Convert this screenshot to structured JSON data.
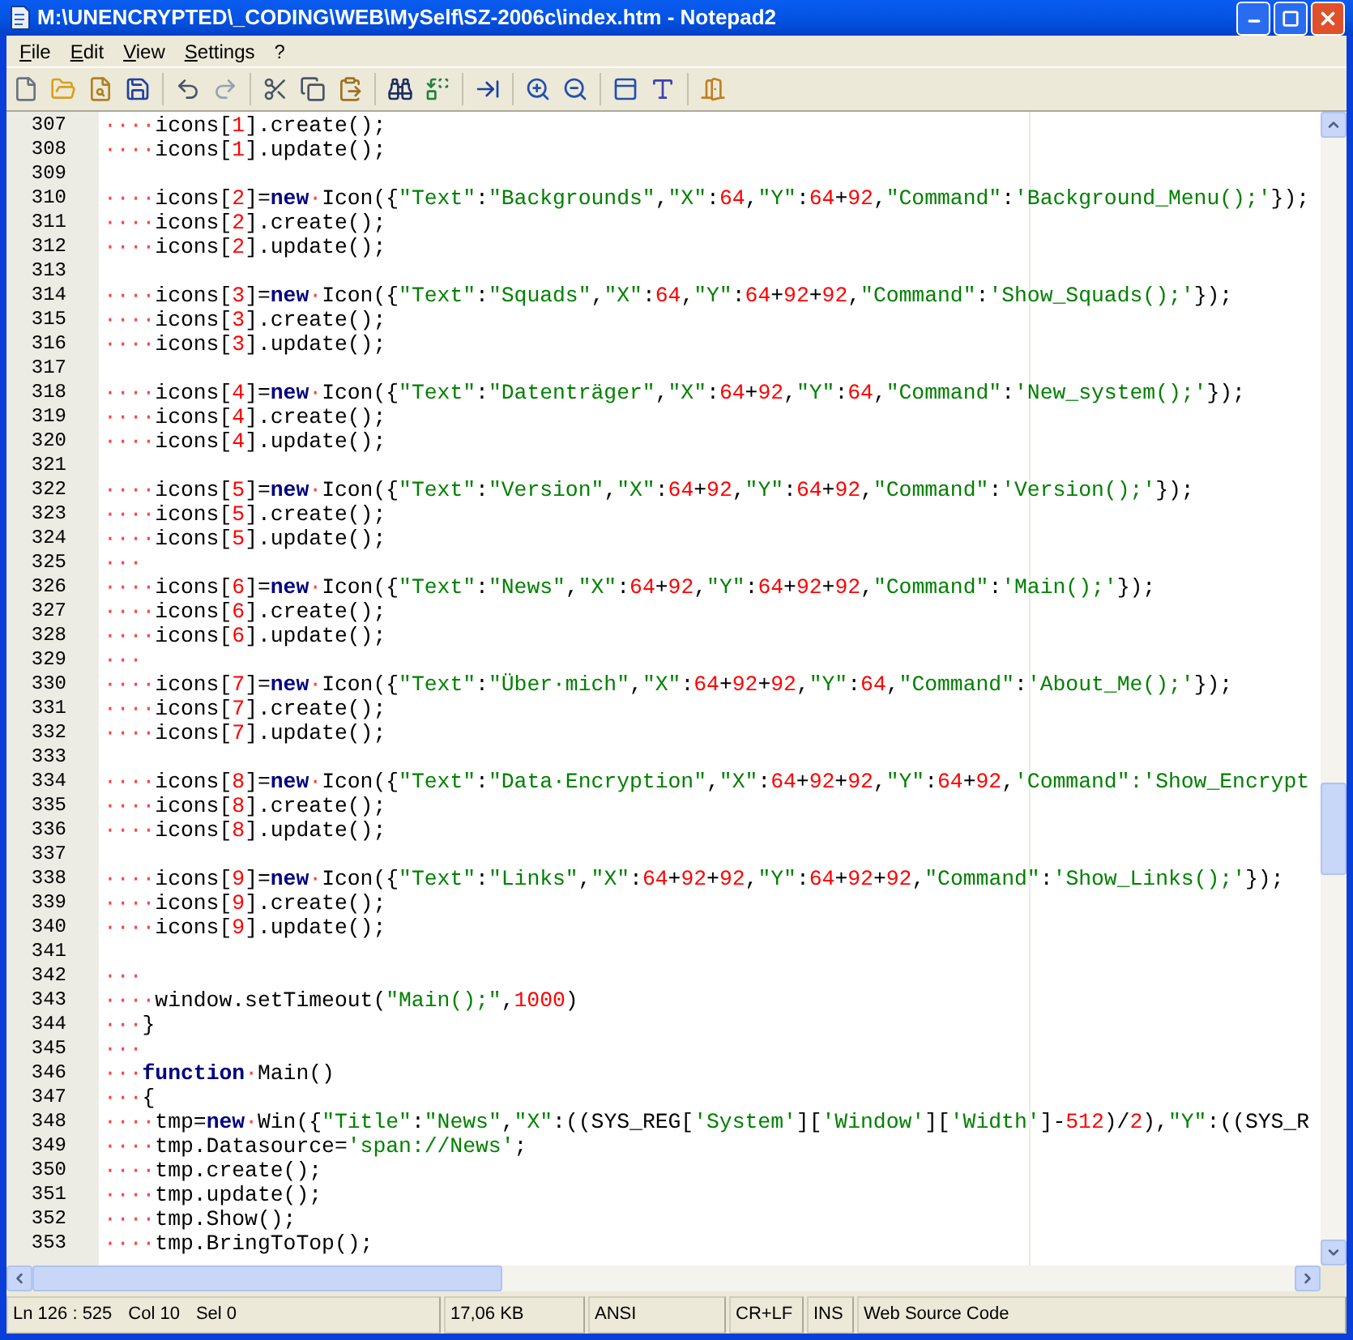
{
  "window": {
    "title": "M:\\UNENCRYPTED\\_CODING\\WEB\\MySelf\\SZ-2006c\\index.htm - Notepad2"
  },
  "menu": [
    {
      "label": "File"
    },
    {
      "label": "Edit"
    },
    {
      "label": "View"
    },
    {
      "label": "Settings"
    },
    {
      "label": "?"
    }
  ],
  "editor": {
    "lines": [
      {
        "number": "307",
        "tokens": [
          {
            "kind": "space",
            "text": "····"
          },
          {
            "kind": "plain",
            "text": "icons["
          },
          {
            "kind": "number",
            "text": "1"
          },
          {
            "kind": "plain",
            "text": "].create();"
          }
        ]
      },
      {
        "number": "308",
        "tokens": [
          {
            "kind": "space",
            "text": "····"
          },
          {
            "kind": "plain",
            "text": "icons["
          },
          {
            "kind": "number",
            "text": "1"
          },
          {
            "kind": "plain",
            "text": "].update();"
          }
        ]
      },
      {
        "number": "309"
      },
      {
        "number": "310",
        "tokens": [
          {
            "kind": "space",
            "text": "····"
          },
          {
            "kind": "plain",
            "text": "icons["
          },
          {
            "kind": "number",
            "text": "2"
          },
          {
            "kind": "plain",
            "text": "]="
          },
          {
            "kind": "keyword",
            "text": "new"
          },
          {
            "kind": "space",
            "text": "·"
          },
          {
            "kind": "plain",
            "text": "Icon({"
          },
          {
            "kind": "string",
            "text": "\"Text\""
          },
          {
            "kind": "plain",
            "text": ":"
          },
          {
            "kind": "string",
            "text": "\"Backgrounds\""
          },
          {
            "kind": "plain",
            "text": ","
          },
          {
            "kind": "string",
            "text": "\"X\""
          },
          {
            "kind": "plain",
            "text": ":"
          },
          {
            "kind": "number",
            "text": "64"
          },
          {
            "kind": "plain",
            "text": ","
          },
          {
            "kind": "string",
            "text": "\"Y\""
          },
          {
            "kind": "plain",
            "text": ":"
          },
          {
            "kind": "number",
            "text": "64"
          },
          {
            "kind": "plain",
            "text": "+"
          },
          {
            "kind": "number",
            "text": "92"
          },
          {
            "kind": "plain",
            "text": ","
          },
          {
            "kind": "string",
            "text": "\"Command\""
          },
          {
            "kind": "plain",
            "text": ":"
          },
          {
            "kind": "string",
            "text": "'Background_Menu();'"
          },
          {
            "kind": "plain",
            "text": "});"
          }
        ]
      },
      {
        "number": "311",
        "tokens": [
          {
            "kind": "space",
            "text": "····"
          },
          {
            "kind": "plain",
            "text": "icons["
          },
          {
            "kind": "number",
            "text": "2"
          },
          {
            "kind": "plain",
            "text": "].create();"
          }
        ]
      },
      {
        "number": "312",
        "tokens": [
          {
            "kind": "space",
            "text": "····"
          },
          {
            "kind": "plain",
            "text": "icons["
          },
          {
            "kind": "number",
            "text": "2"
          },
          {
            "kind": "plain",
            "text": "].update();"
          }
        ]
      },
      {
        "number": "313"
      },
      {
        "number": "314",
        "tokens": [
          {
            "kind": "space",
            "text": "····"
          },
          {
            "kind": "plain",
            "text": "icons["
          },
          {
            "kind": "number",
            "text": "3"
          },
          {
            "kind": "plain",
            "text": "]="
          },
          {
            "kind": "keyword",
            "text": "new"
          },
          {
            "kind": "space",
            "text": "·"
          },
          {
            "kind": "plain",
            "text": "Icon({"
          },
          {
            "kind": "string",
            "text": "\"Text\""
          },
          {
            "kind": "plain",
            "text": ":"
          },
          {
            "kind": "string",
            "text": "\"Squads\""
          },
          {
            "kind": "plain",
            "text": ","
          },
          {
            "kind": "string",
            "text": "\"X\""
          },
          {
            "kind": "plain",
            "text": ":"
          },
          {
            "kind": "number",
            "text": "64"
          },
          {
            "kind": "plain",
            "text": ","
          },
          {
            "kind": "string",
            "text": "\"Y\""
          },
          {
            "kind": "plain",
            "text": ":"
          },
          {
            "kind": "number",
            "text": "64"
          },
          {
            "kind": "plain",
            "text": "+"
          },
          {
            "kind": "number",
            "text": "92"
          },
          {
            "kind": "plain",
            "text": "+"
          },
          {
            "kind": "number",
            "text": "92"
          },
          {
            "kind": "plain",
            "text": ","
          },
          {
            "kind": "string",
            "text": "\"Command\""
          },
          {
            "kind": "plain",
            "text": ":"
          },
          {
            "kind": "string",
            "text": "'Show_Squads();'"
          },
          {
            "kind": "plain",
            "text": "});"
          }
        ]
      },
      {
        "number": "315",
        "tokens": [
          {
            "kind": "space",
            "text": "····"
          },
          {
            "kind": "plain",
            "text": "icons["
          },
          {
            "kind": "number",
            "text": "3"
          },
          {
            "kind": "plain",
            "text": "].create();"
          }
        ]
      },
      {
        "number": "316",
        "tokens": [
          {
            "kind": "space",
            "text": "····"
          },
          {
            "kind": "plain",
            "text": "icons["
          },
          {
            "kind": "number",
            "text": "3"
          },
          {
            "kind": "plain",
            "text": "].update();"
          }
        ]
      },
      {
        "number": "317"
      },
      {
        "number": "318",
        "tokens": [
          {
            "kind": "space",
            "text": "····"
          },
          {
            "kind": "plain",
            "text": "icons["
          },
          {
            "kind": "number",
            "text": "4"
          },
          {
            "kind": "plain",
            "text": "]="
          },
          {
            "kind": "keyword",
            "text": "new"
          },
          {
            "kind": "space",
            "text": "·"
          },
          {
            "kind": "plain",
            "text": "Icon({"
          },
          {
            "kind": "string",
            "text": "\"Text\""
          },
          {
            "kind": "plain",
            "text": ":"
          },
          {
            "kind": "string",
            "text": "\"Datenträger\""
          },
          {
            "kind": "plain",
            "text": ","
          },
          {
            "kind": "string",
            "text": "\"X\""
          },
          {
            "kind": "plain",
            "text": ":"
          },
          {
            "kind": "number",
            "text": "64"
          },
          {
            "kind": "plain",
            "text": "+"
          },
          {
            "kind": "number",
            "text": "92"
          },
          {
            "kind": "plain",
            "text": ","
          },
          {
            "kind": "string",
            "text": "\"Y\""
          },
          {
            "kind": "plain",
            "text": ":"
          },
          {
            "kind": "number",
            "text": "64"
          },
          {
            "kind": "plain",
            "text": ","
          },
          {
            "kind": "string",
            "text": "\"Command\""
          },
          {
            "kind": "plain",
            "text": ":"
          },
          {
            "kind": "string",
            "text": "'New_system();'"
          },
          {
            "kind": "plain",
            "text": "});"
          }
        ]
      },
      {
        "number": "319",
        "tokens": [
          {
            "kind": "space",
            "text": "····"
          },
          {
            "kind": "plain",
            "text": "icons["
          },
          {
            "kind": "number",
            "text": "4"
          },
          {
            "kind": "plain",
            "text": "].create();"
          }
        ]
      },
      {
        "number": "320",
        "tokens": [
          {
            "kind": "space",
            "text": "····"
          },
          {
            "kind": "plain",
            "text": "icons["
          },
          {
            "kind": "number",
            "text": "4"
          },
          {
            "kind": "plain",
            "text": "].update();"
          }
        ]
      },
      {
        "number": "321"
      },
      {
        "number": "322",
        "tokens": [
          {
            "kind": "space",
            "text": "····"
          },
          {
            "kind": "plain",
            "text": "icons["
          },
          {
            "kind": "number",
            "text": "5"
          },
          {
            "kind": "plain",
            "text": "]="
          },
          {
            "kind": "keyword",
            "text": "new"
          },
          {
            "kind": "space",
            "text": "·"
          },
          {
            "kind": "plain",
            "text": "Icon({"
          },
          {
            "kind": "string",
            "text": "\"Text\""
          },
          {
            "kind": "plain",
            "text": ":"
          },
          {
            "kind": "string",
            "text": "\"Version\""
          },
          {
            "kind": "plain",
            "text": ","
          },
          {
            "kind": "string",
            "text": "\"X\""
          },
          {
            "kind": "plain",
            "text": ":"
          },
          {
            "kind": "number",
            "text": "64"
          },
          {
            "kind": "plain",
            "text": "+"
          },
          {
            "kind": "number",
            "text": "92"
          },
          {
            "kind": "plain",
            "text": ","
          },
          {
            "kind": "string",
            "text": "\"Y\""
          },
          {
            "kind": "plain",
            "text": ":"
          },
          {
            "kind": "number",
            "text": "64"
          },
          {
            "kind": "plain",
            "text": "+"
          },
          {
            "kind": "number",
            "text": "92"
          },
          {
            "kind": "plain",
            "text": ","
          },
          {
            "kind": "string",
            "text": "\"Command\""
          },
          {
            "kind": "plain",
            "text": ":"
          },
          {
            "kind": "string",
            "text": "'Version();'"
          },
          {
            "kind": "plain",
            "text": "});"
          }
        ]
      },
      {
        "number": "323",
        "tokens": [
          {
            "kind": "space",
            "text": "····"
          },
          {
            "kind": "plain",
            "text": "icons["
          },
          {
            "kind": "number",
            "text": "5"
          },
          {
            "kind": "plain",
            "text": "].create();"
          }
        ]
      },
      {
        "number": "324",
        "tokens": [
          {
            "kind": "space",
            "text": "····"
          },
          {
            "kind": "plain",
            "text": "icons["
          },
          {
            "kind": "number",
            "text": "5"
          },
          {
            "kind": "plain",
            "text": "].update();"
          }
        ]
      },
      {
        "number": "325",
        "tokens": [
          {
            "kind": "space",
            "text": "···"
          }
        ]
      },
      {
        "number": "326",
        "tokens": [
          {
            "kind": "space",
            "text": "····"
          },
          {
            "kind": "plain",
            "text": "icons["
          },
          {
            "kind": "number",
            "text": "6"
          },
          {
            "kind": "plain",
            "text": "]="
          },
          {
            "kind": "keyword",
            "text": "new"
          },
          {
            "kind": "space",
            "text": "·"
          },
          {
            "kind": "plain",
            "text": "Icon({"
          },
          {
            "kind": "string",
            "text": "\"Text\""
          },
          {
            "kind": "plain",
            "text": ":"
          },
          {
            "kind": "string",
            "text": "\"News\""
          },
          {
            "kind": "plain",
            "text": ","
          },
          {
            "kind": "string",
            "text": "\"X\""
          },
          {
            "kind": "plain",
            "text": ":"
          },
          {
            "kind": "number",
            "text": "64"
          },
          {
            "kind": "plain",
            "text": "+"
          },
          {
            "kind": "number",
            "text": "92"
          },
          {
            "kind": "plain",
            "text": ","
          },
          {
            "kind": "string",
            "text": "\"Y\""
          },
          {
            "kind": "plain",
            "text": ":"
          },
          {
            "kind": "number",
            "text": "64"
          },
          {
            "kind": "plain",
            "text": "+"
          },
          {
            "kind": "number",
            "text": "92"
          },
          {
            "kind": "plain",
            "text": "+"
          },
          {
            "kind": "number",
            "text": "92"
          },
          {
            "kind": "plain",
            "text": ","
          },
          {
            "kind": "string",
            "text": "\"Command\""
          },
          {
            "kind": "plain",
            "text": ":"
          },
          {
            "kind": "string",
            "text": "'Main();'"
          },
          {
            "kind": "plain",
            "text": "});"
          }
        ]
      },
      {
        "number": "327",
        "tokens": [
          {
            "kind": "space",
            "text": "····"
          },
          {
            "kind": "plain",
            "text": "icons["
          },
          {
            "kind": "number",
            "text": "6"
          },
          {
            "kind": "plain",
            "text": "].create();"
          }
        ]
      },
      {
        "number": "328",
        "tokens": [
          {
            "kind": "space",
            "text": "····"
          },
          {
            "kind": "plain",
            "text": "icons["
          },
          {
            "kind": "number",
            "text": "6"
          },
          {
            "kind": "plain",
            "text": "].update();"
          }
        ]
      },
      {
        "number": "329",
        "tokens": [
          {
            "kind": "space",
            "text": "···"
          }
        ]
      },
      {
        "number": "330",
        "tokens": [
          {
            "kind": "space",
            "text": "····"
          },
          {
            "kind": "plain",
            "text": "icons["
          },
          {
            "kind": "number",
            "text": "7"
          },
          {
            "kind": "plain",
            "text": "]="
          },
          {
            "kind": "keyword",
            "text": "new"
          },
          {
            "kind": "space",
            "text": "·"
          },
          {
            "kind": "plain",
            "text": "Icon({"
          },
          {
            "kind": "string",
            "text": "\"Text\""
          },
          {
            "kind": "plain",
            "text": ":"
          },
          {
            "kind": "string",
            "text": "\"Über·mich\""
          },
          {
            "kind": "plain",
            "text": ","
          },
          {
            "kind": "string",
            "text": "\"X\""
          },
          {
            "kind": "plain",
            "text": ":"
          },
          {
            "kind": "number",
            "text": "64"
          },
          {
            "kind": "plain",
            "text": "+"
          },
          {
            "kind": "number",
            "text": "92"
          },
          {
            "kind": "plain",
            "text": "+"
          },
          {
            "kind": "number",
            "text": "92"
          },
          {
            "kind": "plain",
            "text": ","
          },
          {
            "kind": "string",
            "text": "\"Y\""
          },
          {
            "kind": "plain",
            "text": ":"
          },
          {
            "kind": "number",
            "text": "64"
          },
          {
            "kind": "plain",
            "text": ","
          },
          {
            "kind": "string",
            "text": "\"Command\""
          },
          {
            "kind": "plain",
            "text": ":"
          },
          {
            "kind": "string",
            "text": "'About_Me();'"
          },
          {
            "kind": "plain",
            "text": "});"
          }
        ]
      },
      {
        "number": "331",
        "tokens": [
          {
            "kind": "space",
            "text": "····"
          },
          {
            "kind": "plain",
            "text": "icons["
          },
          {
            "kind": "number",
            "text": "7"
          },
          {
            "kind": "plain",
            "text": "].create();"
          }
        ]
      },
      {
        "number": "332",
        "tokens": [
          {
            "kind": "space",
            "text": "····"
          },
          {
            "kind": "plain",
            "text": "icons["
          },
          {
            "kind": "number",
            "text": "7"
          },
          {
            "kind": "plain",
            "text": "].update();"
          }
        ]
      },
      {
        "number": "333"
      },
      {
        "number": "334",
        "tokens": [
          {
            "kind": "space",
            "text": "····"
          },
          {
            "kind": "plain",
            "text": "icons["
          },
          {
            "kind": "number",
            "text": "8"
          },
          {
            "kind": "plain",
            "text": "]="
          },
          {
            "kind": "keyword",
            "text": "new"
          },
          {
            "kind": "space",
            "text": "·"
          },
          {
            "kind": "plain",
            "text": "Icon({"
          },
          {
            "kind": "string",
            "text": "\"Text\""
          },
          {
            "kind": "plain",
            "text": ":"
          },
          {
            "kind": "string",
            "text": "\"Data·Encryption\""
          },
          {
            "kind": "plain",
            "text": ","
          },
          {
            "kind": "string",
            "text": "\"X\""
          },
          {
            "kind": "plain",
            "text": ":"
          },
          {
            "kind": "number",
            "text": "64"
          },
          {
            "kind": "plain",
            "text": "+"
          },
          {
            "kind": "number",
            "text": "92"
          },
          {
            "kind": "plain",
            "text": "+"
          },
          {
            "kind": "number",
            "text": "92"
          },
          {
            "kind": "plain",
            "text": ","
          },
          {
            "kind": "string",
            "text": "\"Y\""
          },
          {
            "kind": "plain",
            "text": ":"
          },
          {
            "kind": "number",
            "text": "64"
          },
          {
            "kind": "plain",
            "text": "+"
          },
          {
            "kind": "number",
            "text": "92"
          },
          {
            "kind": "plain",
            "text": ","
          },
          {
            "kind": "string",
            "text": "'Command\":'Show_Encrypt"
          }
        ]
      },
      {
        "number": "335",
        "tokens": [
          {
            "kind": "space",
            "text": "····"
          },
          {
            "kind": "plain",
            "text": "icons["
          },
          {
            "kind": "number",
            "text": "8"
          },
          {
            "kind": "plain",
            "text": "].create();"
          }
        ]
      },
      {
        "number": "336",
        "tokens": [
          {
            "kind": "space",
            "text": "····"
          },
          {
            "kind": "plain",
            "text": "icons["
          },
          {
            "kind": "number",
            "text": "8"
          },
          {
            "kind": "plain",
            "text": "].update();"
          }
        ]
      },
      {
        "number": "337"
      },
      {
        "number": "338",
        "tokens": [
          {
            "kind": "space",
            "text": "····"
          },
          {
            "kind": "plain",
            "text": "icons["
          },
          {
            "kind": "number",
            "text": "9"
          },
          {
            "kind": "plain",
            "text": "]="
          },
          {
            "kind": "keyword",
            "text": "new"
          },
          {
            "kind": "space",
            "text": "·"
          },
          {
            "kind": "plain",
            "text": "Icon({"
          },
          {
            "kind": "string",
            "text": "\"Text\""
          },
          {
            "kind": "plain",
            "text": ":"
          },
          {
            "kind": "string",
            "text": "\"Links\""
          },
          {
            "kind": "plain",
            "text": ","
          },
          {
            "kind": "string",
            "text": "\"X\""
          },
          {
            "kind": "plain",
            "text": ":"
          },
          {
            "kind": "number",
            "text": "64"
          },
          {
            "kind": "plain",
            "text": "+"
          },
          {
            "kind": "number",
            "text": "92"
          },
          {
            "kind": "plain",
            "text": "+"
          },
          {
            "kind": "number",
            "text": "92"
          },
          {
            "kind": "plain",
            "text": ","
          },
          {
            "kind": "string",
            "text": "\"Y\""
          },
          {
            "kind": "plain",
            "text": ":"
          },
          {
            "kind": "number",
            "text": "64"
          },
          {
            "kind": "plain",
            "text": "+"
          },
          {
            "kind": "number",
            "text": "92"
          },
          {
            "kind": "plain",
            "text": "+"
          },
          {
            "kind": "number",
            "text": "92"
          },
          {
            "kind": "plain",
            "text": ","
          },
          {
            "kind": "string",
            "text": "\"Command\""
          },
          {
            "kind": "plain",
            "text": ":"
          },
          {
            "kind": "string",
            "text": "'Show_Links();'"
          },
          {
            "kind": "plain",
            "text": "});"
          }
        ]
      },
      {
        "number": "339",
        "tokens": [
          {
            "kind": "space",
            "text": "····"
          },
          {
            "kind": "plain",
            "text": "icons["
          },
          {
            "kind": "number",
            "text": "9"
          },
          {
            "kind": "plain",
            "text": "].create();"
          }
        ]
      },
      {
        "number": "340",
        "tokens": [
          {
            "kind": "space",
            "text": "····"
          },
          {
            "kind": "plain",
            "text": "icons["
          },
          {
            "kind": "number",
            "text": "9"
          },
          {
            "kind": "plain",
            "text": "].update();"
          }
        ]
      },
      {
        "number": "341"
      },
      {
        "number": "342",
        "tokens": [
          {
            "kind": "space",
            "text": "···"
          }
        ]
      },
      {
        "number": "343",
        "tokens": [
          {
            "kind": "space",
            "text": "····"
          },
          {
            "kind": "plain",
            "text": "window.setTimeout("
          },
          {
            "kind": "string",
            "text": "\"Main();\""
          },
          {
            "kind": "plain",
            "text": ","
          },
          {
            "kind": "number",
            "text": "1000"
          },
          {
            "kind": "plain",
            "text": ")"
          }
        ]
      },
      {
        "number": "344",
        "tokens": [
          {
            "kind": "space",
            "text": "···"
          },
          {
            "kind": "plain",
            "text": "}"
          }
        ]
      },
      {
        "number": "345",
        "tokens": [
          {
            "kind": "space",
            "text": "···"
          }
        ]
      },
      {
        "number": "346",
        "tokens": [
          {
            "kind": "space",
            "text": "···"
          },
          {
            "kind": "keyword",
            "text": "function"
          },
          {
            "kind": "space",
            "text": "·"
          },
          {
            "kind": "plain",
            "text": "Main()"
          }
        ]
      },
      {
        "number": "347",
        "tokens": [
          {
            "kind": "space",
            "text": "···"
          },
          {
            "kind": "plain",
            "text": "{"
          }
        ]
      },
      {
        "number": "348",
        "tokens": [
          {
            "kind": "space",
            "text": "····"
          },
          {
            "kind": "plain",
            "text": "tmp="
          },
          {
            "kind": "keyword",
            "text": "new"
          },
          {
            "kind": "space",
            "text": "·"
          },
          {
            "kind": "plain",
            "text": "Win({"
          },
          {
            "kind": "string",
            "text": "\"Title\""
          },
          {
            "kind": "plain",
            "text": ":"
          },
          {
            "kind": "string",
            "text": "\"News\""
          },
          {
            "kind": "plain",
            "text": ","
          },
          {
            "kind": "string",
            "text": "\"X\""
          },
          {
            "kind": "plain",
            "text": ":((SYS_REG["
          },
          {
            "kind": "string",
            "text": "'System'"
          },
          {
            "kind": "plain",
            "text": "]["
          },
          {
            "kind": "string",
            "text": "'Window'"
          },
          {
            "kind": "plain",
            "text": "]["
          },
          {
            "kind": "string",
            "text": "'Width'"
          },
          {
            "kind": "plain",
            "text": "]-"
          },
          {
            "kind": "number",
            "text": "512"
          },
          {
            "kind": "plain",
            "text": ")/"
          },
          {
            "kind": "number",
            "text": "2"
          },
          {
            "kind": "plain",
            "text": "),"
          },
          {
            "kind": "string",
            "text": "\"Y\""
          },
          {
            "kind": "plain",
            "text": ":((SYS_R"
          }
        ]
      },
      {
        "number": "349",
        "tokens": [
          {
            "kind": "space",
            "text": "····"
          },
          {
            "kind": "plain",
            "text": "tmp.Datasource="
          },
          {
            "kind": "string",
            "text": "'span://News'"
          },
          {
            "kind": "plain",
            "text": ";"
          }
        ]
      },
      {
        "number": "350",
        "tokens": [
          {
            "kind": "space",
            "text": "····"
          },
          {
            "kind": "plain",
            "text": "tmp.create();"
          }
        ]
      },
      {
        "number": "351",
        "tokens": [
          {
            "kind": "space",
            "text": "····"
          },
          {
            "kind": "plain",
            "text": "tmp.update();"
          }
        ]
      },
      {
        "number": "352",
        "tokens": [
          {
            "kind": "space",
            "text": "····"
          },
          {
            "kind": "plain",
            "text": "tmp.Show();"
          }
        ]
      },
      {
        "number": "353",
        "tokens": [
          {
            "kind": "space",
            "text": "····"
          },
          {
            "kind": "plain",
            "text": "tmp.BringToTop();"
          }
        ]
      }
    ]
  },
  "status_bar": [
    {
      "items": [
        "Ln 126 : 525",
        "Col 10",
        "Sel 0"
      ]
    },
    {
      "items": [
        "17,06 KB"
      ]
    },
    {
      "items": [
        "ANSI"
      ]
    },
    {
      "items": [
        "CR+LF"
      ]
    },
    {
      "items": [
        "INS"
      ]
    },
    {
      "items": [
        "Web Source Code"
      ]
    }
  ]
}
